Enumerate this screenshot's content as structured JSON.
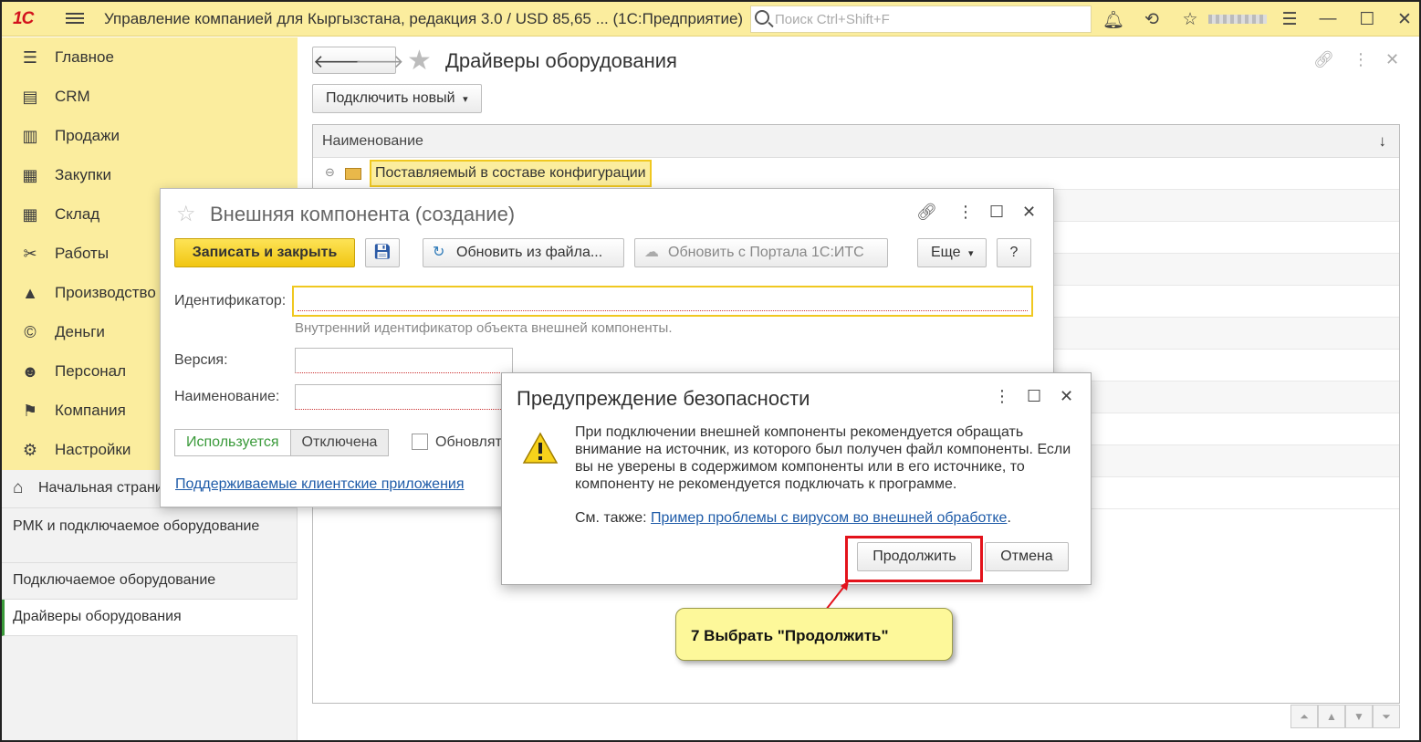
{
  "titlebar": {
    "logo": "1С",
    "title": "Управление компанией для Кыргызстана, редакция 3.0 / USD 85,65 ...  (1С:Предприятие)",
    "search_placeholder": "Поиск Ctrl+Shift+F"
  },
  "sidebar": {
    "items": [
      {
        "label": "Главное",
        "icon": "☰"
      },
      {
        "label": "CRM",
        "icon": "▤"
      },
      {
        "label": "Продажи",
        "icon": "▥"
      },
      {
        "label": "Закупки",
        "icon": "▦"
      },
      {
        "label": "Склад",
        "icon": "▦"
      },
      {
        "label": "Работы",
        "icon": "✂"
      },
      {
        "label": "Производство",
        "icon": "▲"
      },
      {
        "label": "Деньги",
        "icon": "©"
      },
      {
        "label": "Персонал",
        "icon": "☻"
      },
      {
        "label": "Компания",
        "icon": "⚑"
      },
      {
        "label": "Настройки",
        "icon": "⚙"
      }
    ],
    "nav": {
      "home": "Начальная страница",
      "link1": "РМК и подключаемое оборудование",
      "link2": "Подключаемое оборудование",
      "link3": "Драйверы оборудования"
    }
  },
  "main": {
    "title": "Драйверы оборудования",
    "connect_new": "Подключить новый",
    "column": "Наименование",
    "sort_arrow": "↓",
    "row1": "Поставляемый в составе конфигурации"
  },
  "dlg1": {
    "title": "Внешняя компонента (создание)",
    "save_close": "Записать и закрыть",
    "update_file": "Обновить из файла...",
    "update_portal": "Обновить с Портала 1С:ИТС",
    "more": "Еще",
    "help": "?",
    "id_label": "Идентификатор:",
    "id_hint": "Внутренний идентификатор объекта внешней компоненты.",
    "version_label": "Версия:",
    "name_label": "Наименование:",
    "used": "Используется",
    "disabled": "Отключена",
    "update_check": "Обновлять",
    "supported_link": "Поддерживаемые клиентские приложения"
  },
  "dlg2": {
    "title": "Предупреждение безопасности",
    "message": "При подключении внешней компоненты рекомендуется обращать внимание на источник, из которого был получен файл компоненты. Если вы не уверены в содержимом компоненты или в его источнике, то компоненту не рекомендуется подключать к программе.",
    "see_also": "См. также:",
    "see_link": "Пример проблемы с вирусом во внешней обработке",
    "continue": "Продолжить",
    "cancel": "Отмена"
  },
  "callout": {
    "text": "7 Выбрать \"Продолжить\""
  },
  "colors": {
    "brand_yellow": "#fbed9e",
    "accent_red": "#e3121b",
    "link_blue": "#1e5ba8"
  }
}
